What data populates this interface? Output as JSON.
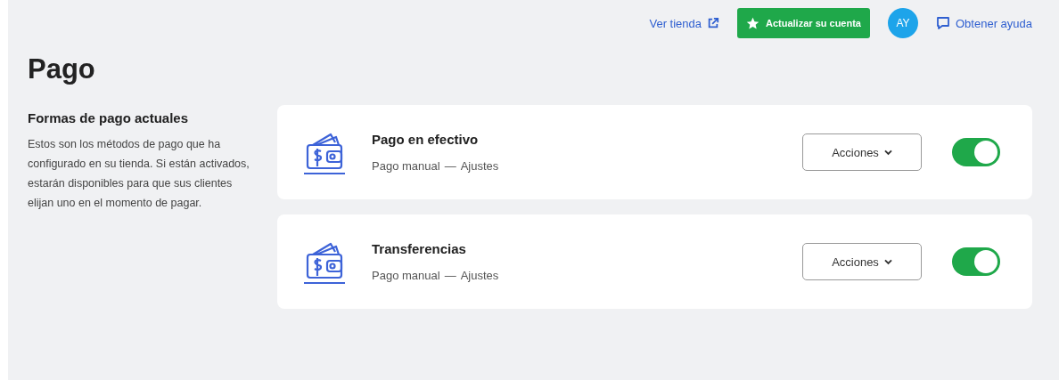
{
  "header": {
    "store_link": "Ver tienda",
    "upgrade_button": "Actualizar su cuenta",
    "avatar": "AY",
    "help_link": "Obtener ayuda"
  },
  "page_title": "Pago",
  "intro": {
    "heading": "Formas de pago actuales",
    "text": "Estos son los métodos de pago que ha configurado en su tienda. Si están activados, estarán disponibles para que sus clientes elijan uno en el momento de pagar."
  },
  "methods": [
    {
      "name": "Pago en efectivo",
      "type": "Pago manual",
      "separator": "—",
      "settings_link": "Ajustes",
      "actions_button": "Acciones",
      "on": true
    },
    {
      "name": "Transferencias",
      "type": "Pago manual",
      "separator": "—",
      "settings_link": "Ajustes",
      "actions_button": "Acciones",
      "on": true
    }
  ]
}
